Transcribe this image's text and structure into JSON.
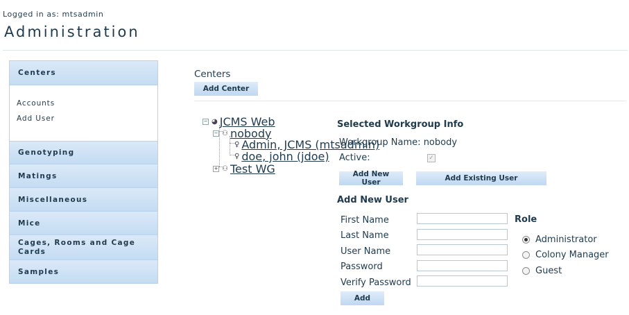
{
  "header": {
    "logged_in": "Logged in as: mtsadmin",
    "title": "Administration"
  },
  "sidebar": {
    "sections": [
      {
        "label": "Centers"
      },
      {
        "label": "Genotyping"
      },
      {
        "label": "Matings"
      },
      {
        "label": "Miscellaneous"
      },
      {
        "label": "Mice"
      },
      {
        "label": "Cages, Rooms and Cage Cards"
      },
      {
        "label": "Samples"
      }
    ],
    "centers_links": [
      "Accounts",
      "Add User"
    ]
  },
  "main": {
    "section_label": "Centers",
    "add_center_label": "Add Center"
  },
  "tree": {
    "root": "JCMS Web",
    "group1": "nobody",
    "users": [
      "Admin, JCMS (mtsadmin)",
      "doe, john (jdoe)"
    ],
    "group2": "Test WG",
    "expand_minus": "−",
    "expand_plus": "+"
  },
  "workgroup": {
    "title": "Selected Workgroup Info",
    "name_label": "Workgroup Name:",
    "name_value": "nobody",
    "active_label": "Active:",
    "active_checked": true,
    "add_new_user_btn": "Add New User",
    "add_existing_user_btn": "Add Existing User"
  },
  "new_user_form": {
    "title": "Add New User",
    "fields": [
      {
        "label": "First Name",
        "value": ""
      },
      {
        "label": "Last Name",
        "value": ""
      },
      {
        "label": "User Name",
        "value": ""
      },
      {
        "label": "Password",
        "value": ""
      },
      {
        "label": "Verify Password",
        "value": ""
      }
    ],
    "add_btn": "Add",
    "role_title": "Role",
    "roles": [
      {
        "label": "Administrator",
        "selected": true
      },
      {
        "label": "Colony Manager",
        "selected": false
      },
      {
        "label": "Guest",
        "selected": false
      }
    ]
  },
  "colors": {
    "text": "#1f3a4d",
    "nav_gradient_top": "#dbe9f8",
    "nav_gradient_bottom": "#c4dcf2",
    "nav_border": "#b7d2ea"
  }
}
